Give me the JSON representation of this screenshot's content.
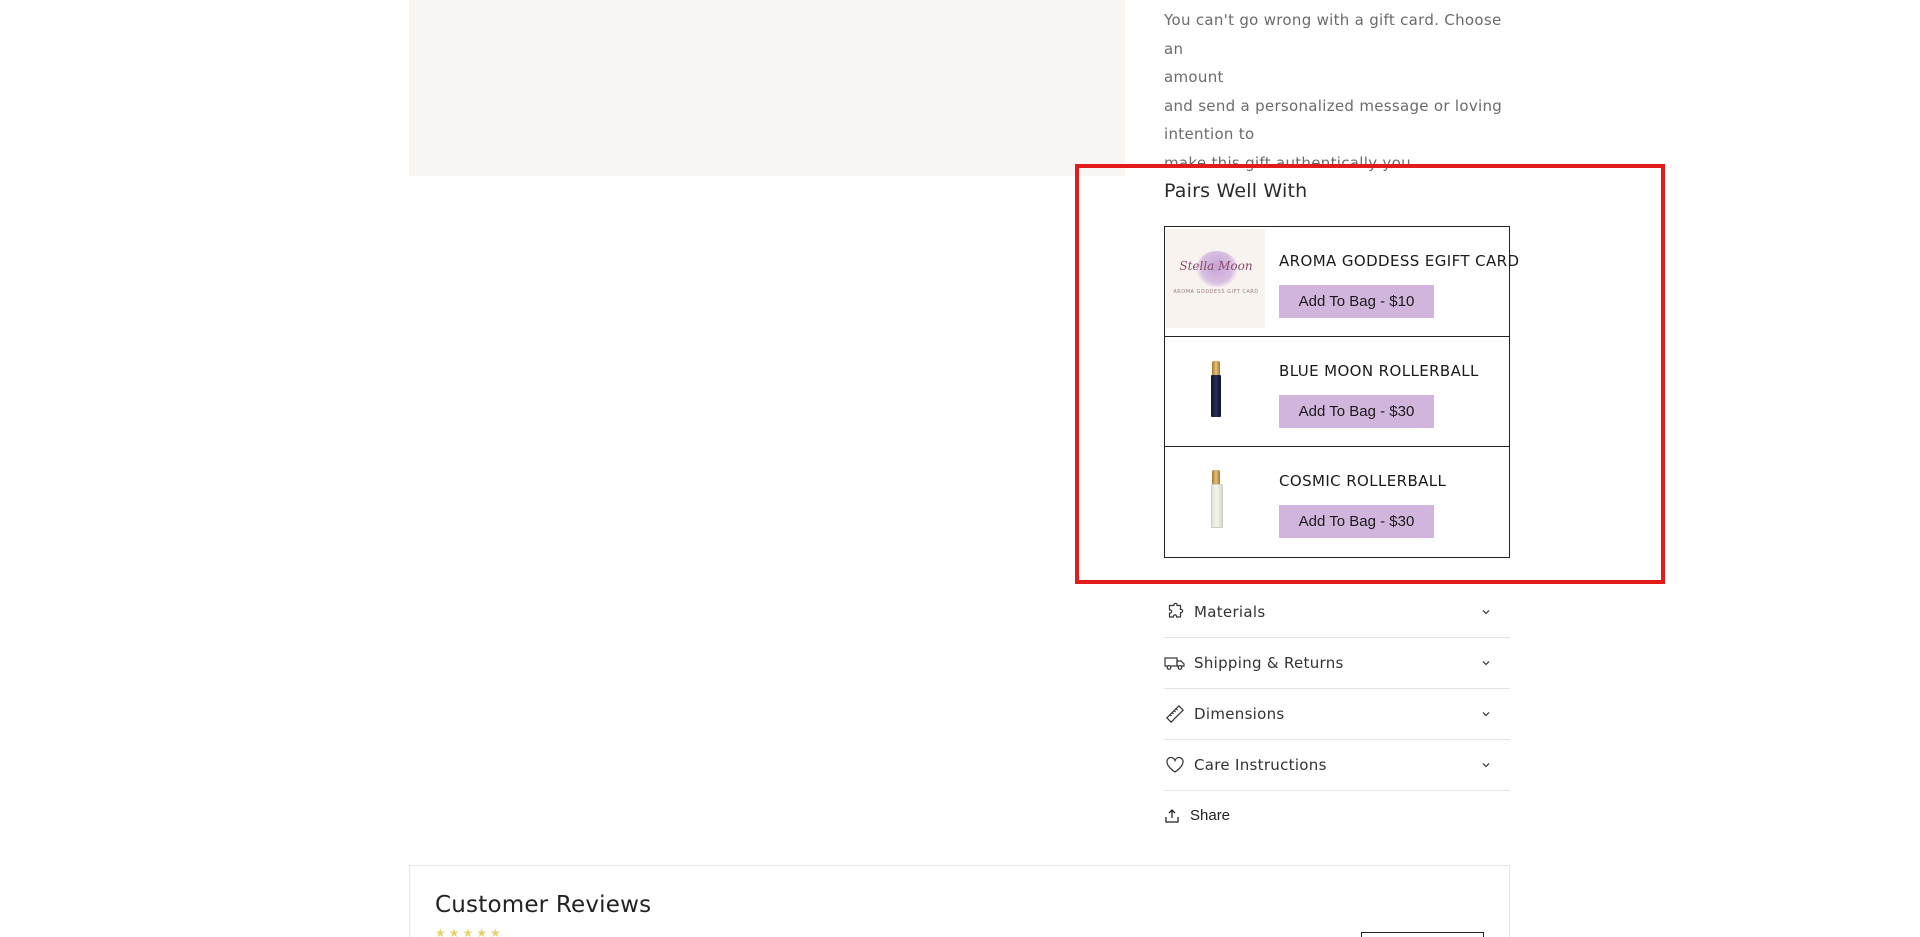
{
  "description": {
    "lines": [
      "You can't go wrong with a gift card. Choose an",
      "amount",
      "and send a personalized message or loving",
      "intention to",
      "make this gift authentically you."
    ]
  },
  "pairs_well_with": {
    "title": "Pairs Well With",
    "items": [
      {
        "name": "AROMA GODDESS EGIFT CARD",
        "button_label": "Add To Bag - $10",
        "thumbnail": "gift-card-image",
        "thumb_script": "Stella Moon",
        "thumb_caption": "AROMA GODDESS GIFT CARD"
      },
      {
        "name": "BLUE MOON ROLLERBALL",
        "button_label": "Add To Bag - $30",
        "thumbnail": "blue-rollerball-bottle"
      },
      {
        "name": "COSMIC ROLLERBALL",
        "button_label": "Add To Bag - $30",
        "thumbnail": "clear-rollerball-bottle"
      }
    ]
  },
  "accordion": [
    {
      "label": "Materials",
      "icon": "puzzle-icon"
    },
    {
      "label": "Shipping & Returns",
      "icon": "truck-icon"
    },
    {
      "label": "Dimensions",
      "icon": "ruler-icon"
    },
    {
      "label": "Care Instructions",
      "icon": "heart-icon"
    }
  ],
  "share": {
    "label": "Share",
    "icon": "share-icon"
  },
  "reviews": {
    "title": "Customer Reviews",
    "stars": "★★★★★"
  },
  "colors": {
    "highlight_border": "#e31b1b",
    "add_button_bg": "#d2b5dd",
    "media_bg": "#f9f5f3",
    "star": "#e8d26a"
  }
}
